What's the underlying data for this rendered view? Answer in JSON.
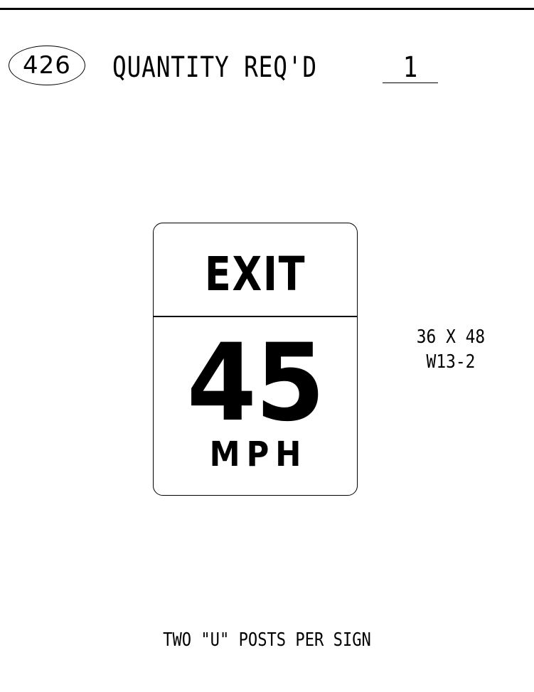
{
  "header": {
    "sign_number": "426",
    "quantity_label": "QUANTITY REQ'D",
    "quantity_value": "1"
  },
  "sign": {
    "top_legend": "EXIT",
    "speed": "45",
    "unit": "MPH"
  },
  "spec": {
    "size": "36 X 48",
    "code": "W13-2"
  },
  "note": "TWO \"U\" POSTS PER SIGN"
}
